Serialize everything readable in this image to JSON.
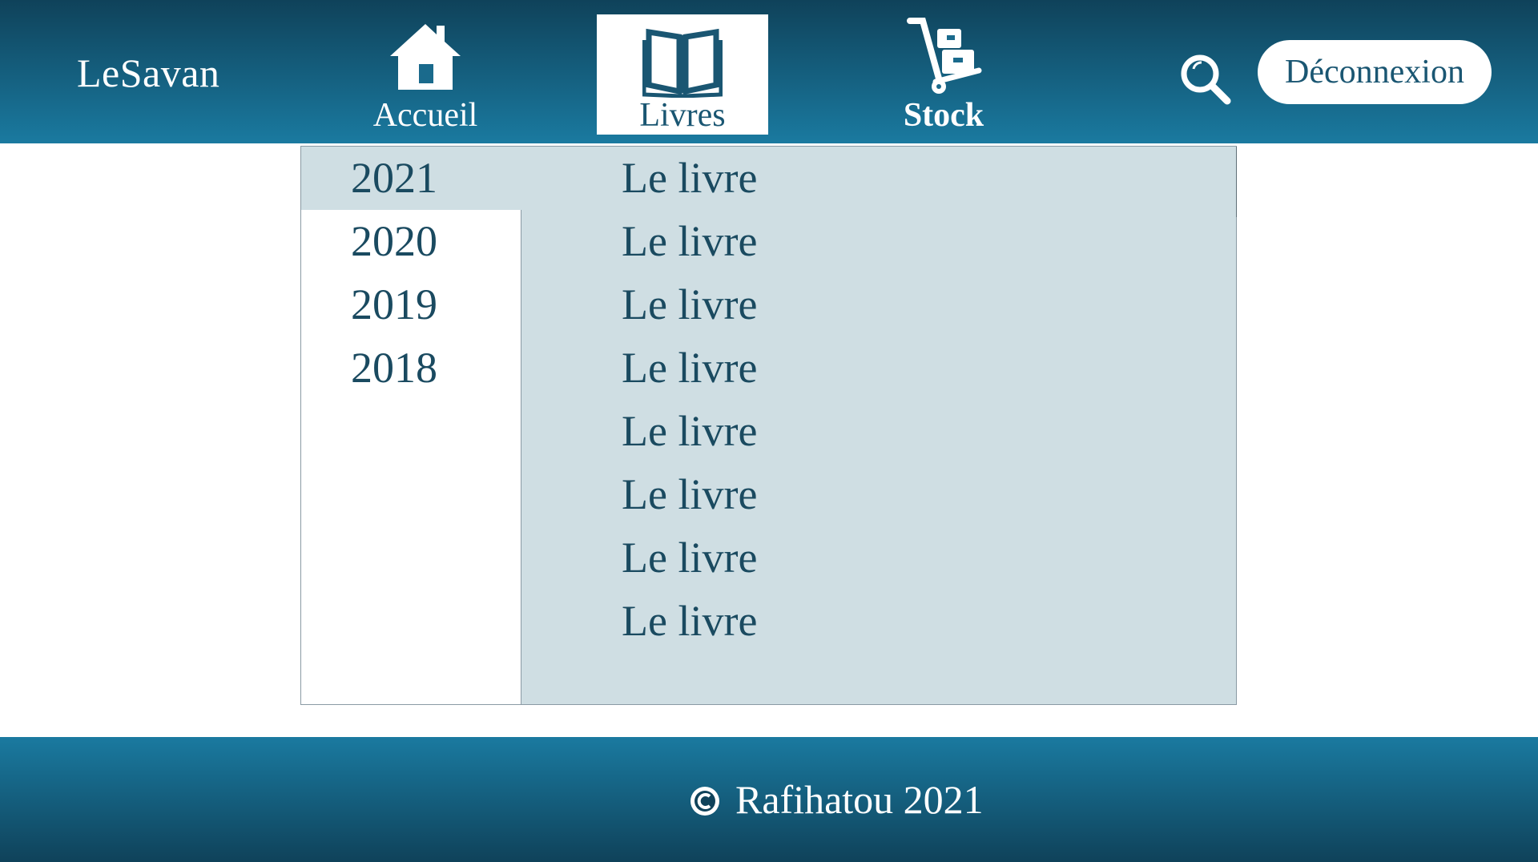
{
  "header": {
    "brand": "LeSavan",
    "nav": [
      {
        "label": "Accueil",
        "icon": "home-icon",
        "active": false
      },
      {
        "label": "Livres",
        "icon": "book-icon",
        "active": true
      },
      {
        "label": "Stock",
        "icon": "hand-truck-icon",
        "active": false
      }
    ],
    "search_icon": "search-icon",
    "logout_label": "Déconnexion"
  },
  "years": [
    {
      "label": "2021",
      "active": true
    },
    {
      "label": "2020",
      "active": false
    },
    {
      "label": "2019",
      "active": false
    },
    {
      "label": "2018",
      "active": false
    }
  ],
  "books": [
    {
      "title": "Le livre"
    },
    {
      "title": "Le livre"
    },
    {
      "title": "Le livre"
    },
    {
      "title": "Le livre"
    },
    {
      "title": "Le livre"
    },
    {
      "title": "Le livre"
    },
    {
      "title": "Le livre"
    },
    {
      "title": "Le livre"
    }
  ],
  "footer": {
    "copyright_text": "Rafihatou 2021",
    "copyright_icon": "copyright-icon"
  },
  "colors": {
    "header_dark": "#0f425a",
    "header_light": "#1a7aa0",
    "panel_bg": "#cfdee3",
    "text_dark": "#1a4a60"
  }
}
